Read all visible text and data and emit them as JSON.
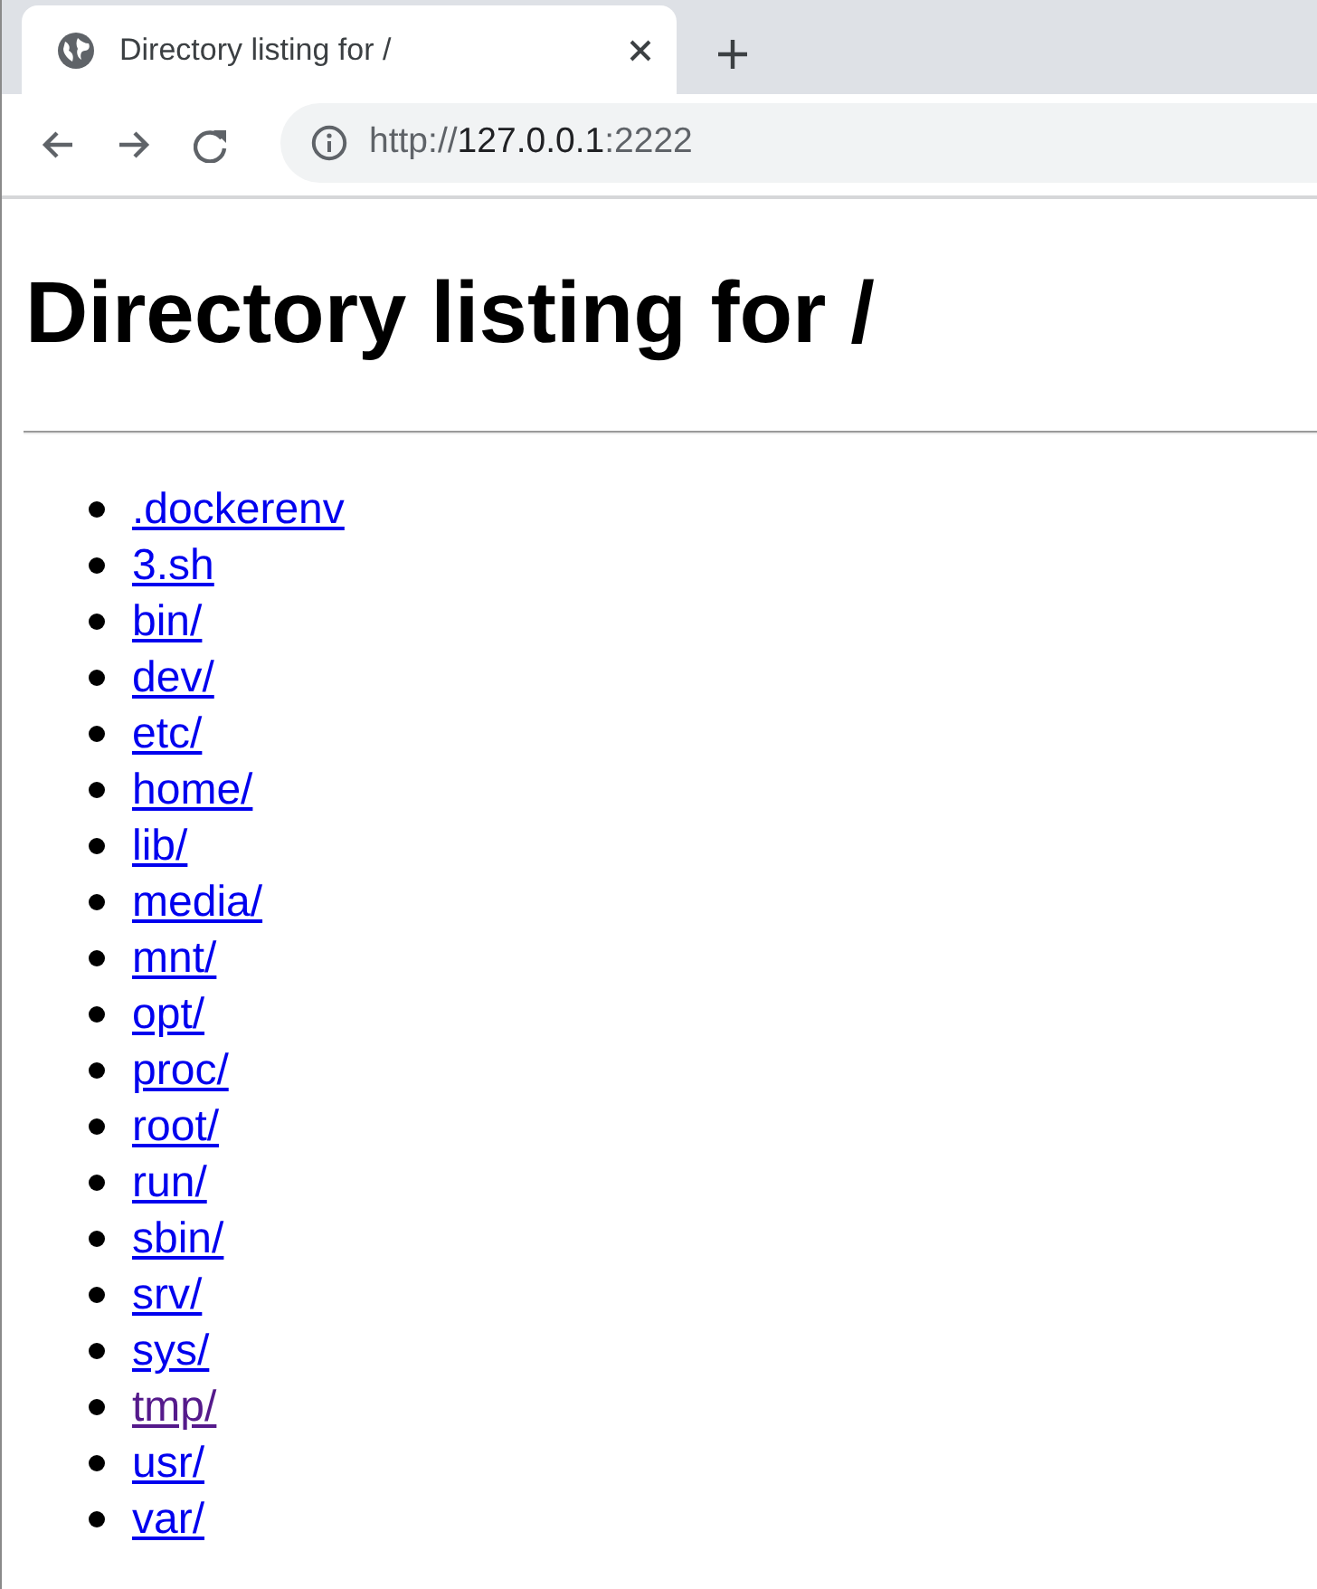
{
  "browser": {
    "tab": {
      "title": "Directory listing for /",
      "selected": true
    },
    "address": {
      "scheme": "http://",
      "host": "127.0.0.1",
      "port": ":2222"
    }
  },
  "page": {
    "heading": "Directory listing for /",
    "entries": [
      {
        "name": ".dockerenv",
        "visited": false
      },
      {
        "name": "3.sh",
        "visited": false
      },
      {
        "name": "bin/",
        "visited": false
      },
      {
        "name": "dev/",
        "visited": false
      },
      {
        "name": "etc/",
        "visited": false
      },
      {
        "name": "home/",
        "visited": false
      },
      {
        "name": "lib/",
        "visited": false
      },
      {
        "name": "media/",
        "visited": false
      },
      {
        "name": "mnt/",
        "visited": false
      },
      {
        "name": "opt/",
        "visited": false
      },
      {
        "name": "proc/",
        "visited": false
      },
      {
        "name": "root/",
        "visited": false
      },
      {
        "name": "run/",
        "visited": false
      },
      {
        "name": "sbin/",
        "visited": false
      },
      {
        "name": "srv/",
        "visited": false
      },
      {
        "name": "sys/",
        "visited": false
      },
      {
        "name": "tmp/",
        "visited": true
      },
      {
        "name": "usr/",
        "visited": false
      },
      {
        "name": "var/",
        "visited": false
      }
    ]
  }
}
